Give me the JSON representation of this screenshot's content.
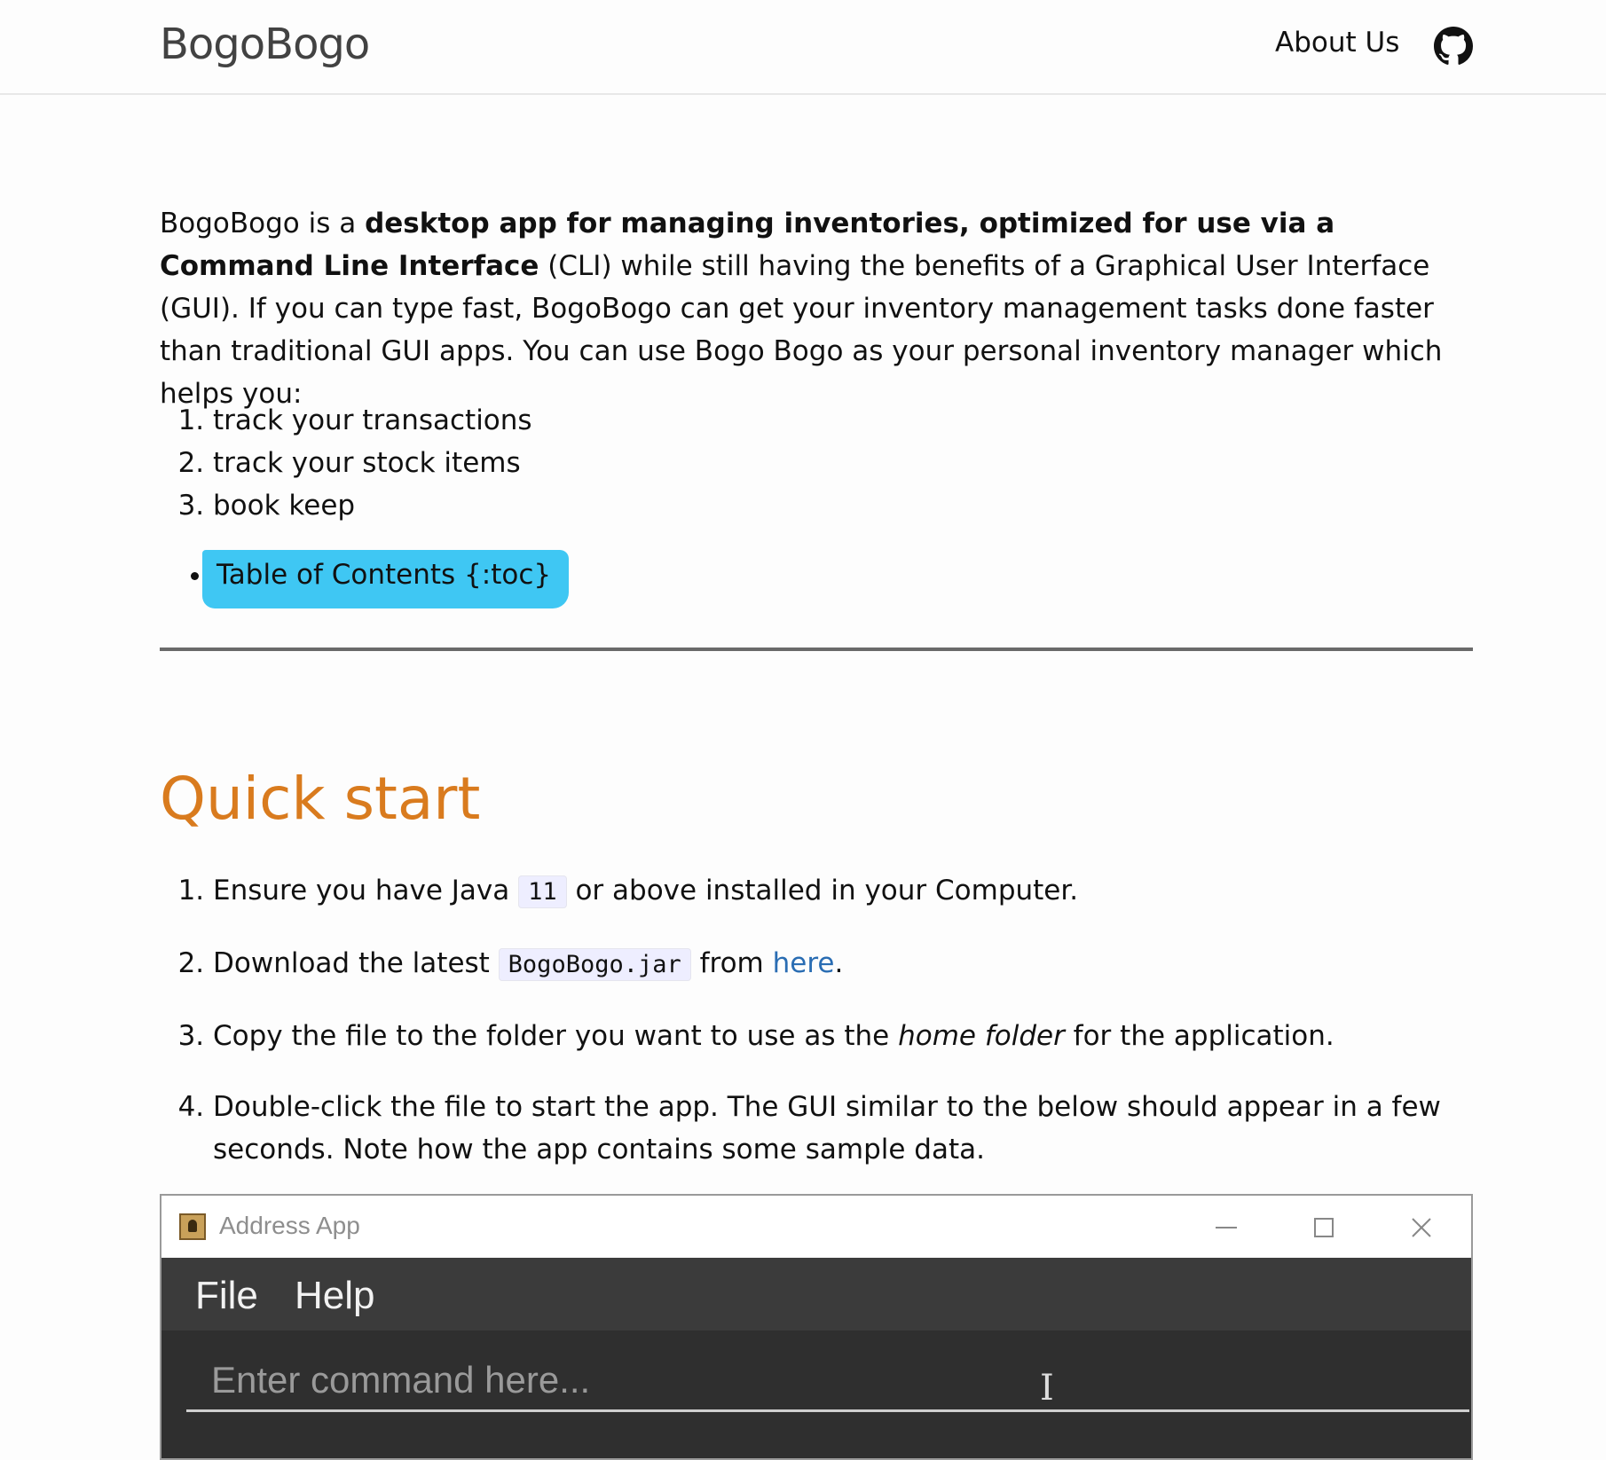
{
  "header": {
    "site_title": "BogoBogo",
    "nav": {
      "about_label": "About Us"
    },
    "github_icon": "github-icon"
  },
  "intro": {
    "p1": "BogoBogo is a ",
    "b1": "desktop app for managing inventories, optimized for use via a Command Line Interface",
    "p2": " (CLI) while still having the benefits of a Graphical User Interface (GUI). If you can type fast, BogoBogo can get your inventory management tasks done faster than traditional GUI apps. You can use Bogo Bogo as your personal inventory manager which helps you:"
  },
  "features": [
    "track your transactions",
    "track your stock items",
    "book keep"
  ],
  "toc": {
    "label": "Table of Contents {:toc}",
    "highlight_color": "#3fc7f3"
  },
  "quick_start": {
    "title": "Quick start",
    "title_color": "#d97b1e",
    "steps": [
      {
        "a": "Ensure you have Java ",
        "code": "11",
        "b": " or above installed in your Computer."
      },
      {
        "a": "Download the latest ",
        "code": "BogoBogo.jar",
        "b": " from ",
        "link": "here",
        "c": "."
      },
      {
        "a": "Copy the file to the folder you want to use as the ",
        "em": "home folder",
        "b": " for the application."
      },
      {
        "a": "Double-click the file to start the app. The GUI similar to the below should appear in a few seconds. Note how the app contains some sample data."
      }
    ]
  },
  "app_window": {
    "title": "Address App",
    "menu": [
      "File",
      "Help"
    ],
    "command_placeholder": "Enter command here..."
  }
}
